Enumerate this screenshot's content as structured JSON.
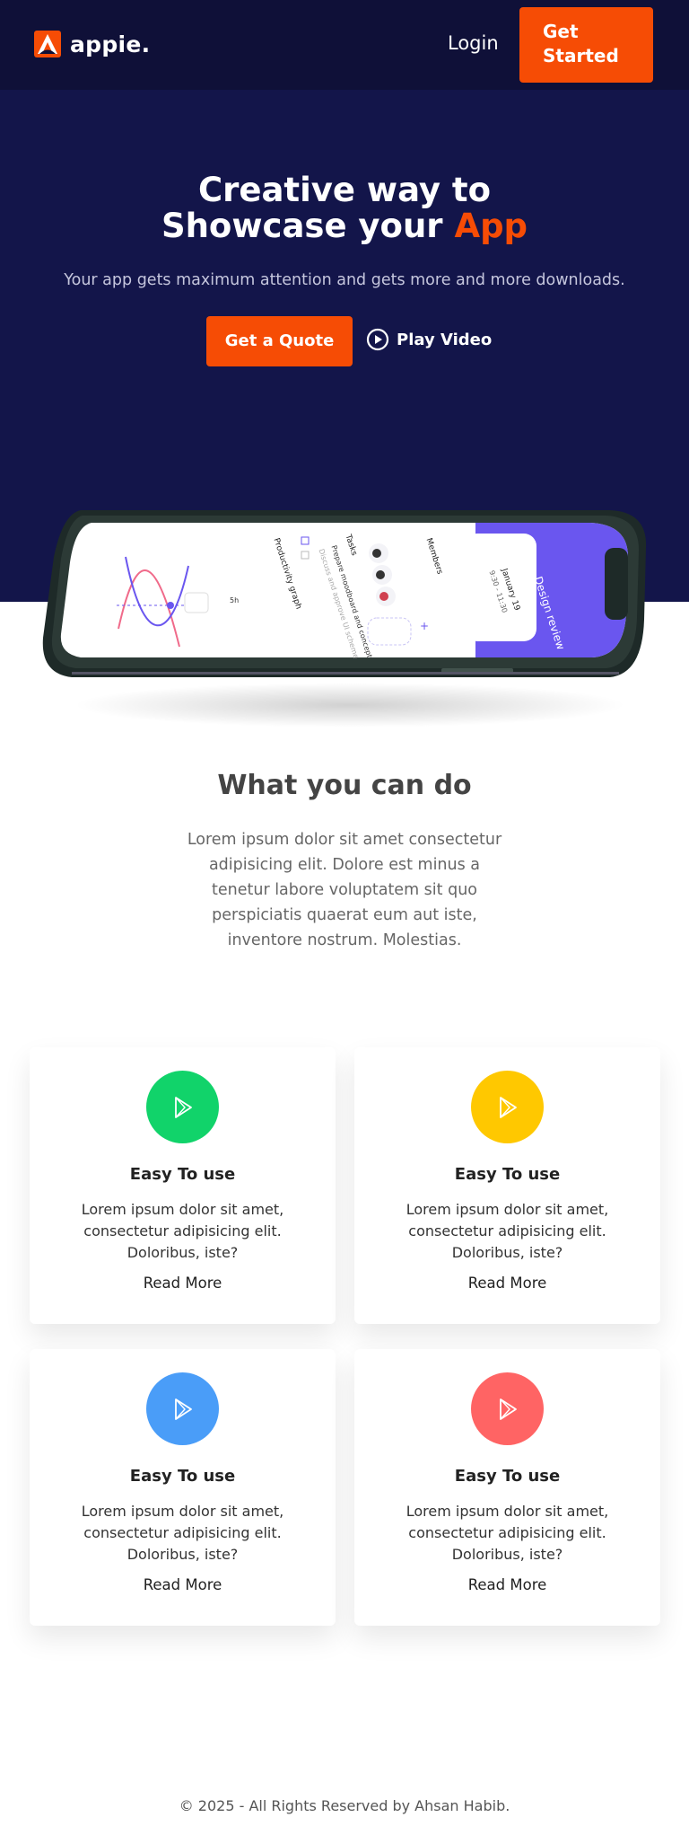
{
  "header": {
    "logo_text": "appie.",
    "login_label": "Login",
    "start_label_line1": "Get",
    "start_label_line2": "Started"
  },
  "hero": {
    "title_line1": "Creative way to",
    "title_line2_prefix": "Showcase your ",
    "title_line2_accent": "App",
    "subtitle": "Your app gets maximum attention and gets more and more downloads.",
    "quote_label": "Get a Quote",
    "video_label": "Play Video"
  },
  "phone_screen": {
    "header_title": "Design review",
    "date_chip": "January 19",
    "time": "9:30 - 11:30",
    "members_label": "Members",
    "tasks_label": "Tasks",
    "task1": "Prepare moodboard and concept",
    "task2": "Discuss and approve UI scheme",
    "graph_label": "Productivity graph",
    "graph_badge": "5h",
    "add_symbol": "+"
  },
  "features": {
    "title": "What you can do",
    "description": "Lorem ipsum dolor sit amet consectetur adipisicing elit. Dolore est minus a tenetur labore voluptatem sit quo perspiciatis quaerat eum aut iste, inventore nostrum. Molestias.",
    "cards": [
      {
        "title": "Easy To use",
        "text": "Lorem ipsum dolor sit amet, consectetur adipisicing elit. Doloribus, iste?",
        "link": "Read More",
        "icon": "play-store-icon",
        "color": "#11d36a"
      },
      {
        "title": "Easy To use",
        "text": "Lorem ipsum dolor sit amet, consectetur adipisicing elit. Doloribus, iste?",
        "link": "Read More",
        "icon": "play-store-icon",
        "color": "#ffc800"
      },
      {
        "title": "Easy To use",
        "text": "Lorem ipsum dolor sit amet, consectetur adipisicing elit. Doloribus, iste?",
        "link": "Read More",
        "icon": "play-store-icon",
        "color": "#4a9df8"
      },
      {
        "title": "Easy To use",
        "text": "Lorem ipsum dolor sit amet, consectetur adipisicing elit. Doloribus, iste?",
        "link": "Read More",
        "icon": "play-store-icon",
        "color": "#ff6464"
      }
    ]
  },
  "footer": {
    "copyright": "© 2025 - All Rights Reserved by Ahsan Habib."
  },
  "colors": {
    "header_bg": "#0f1038",
    "hero_bg": "#13154a",
    "accent": "#f64c05",
    "screen_accent": "#6a56ef"
  }
}
